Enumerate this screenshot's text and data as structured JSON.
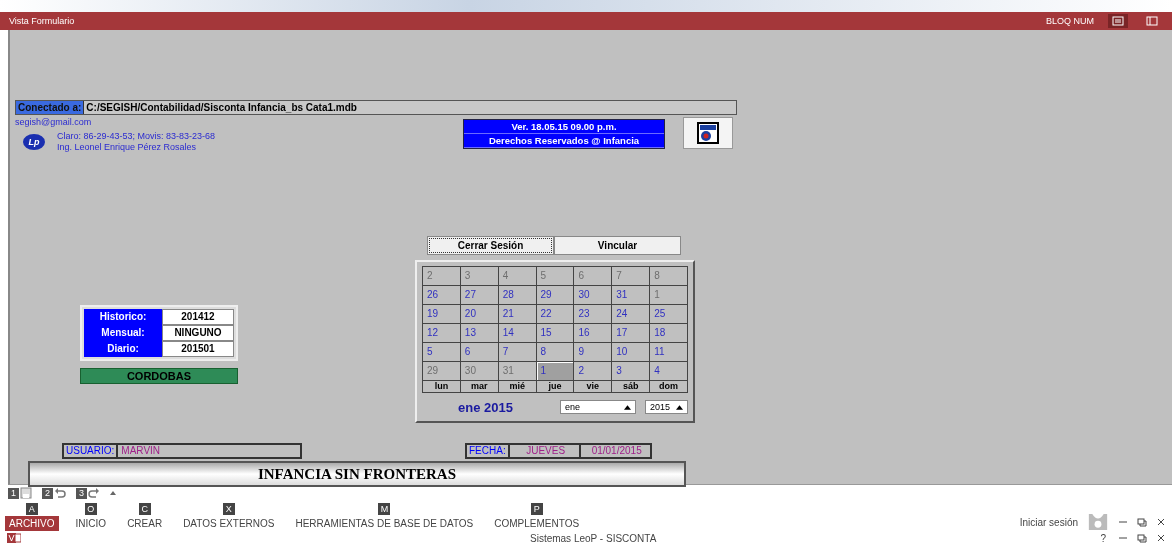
{
  "status_bar": {
    "left": "Vista Formulario",
    "right": "BLOQ NUM"
  },
  "form": {
    "connection": {
      "label": "Conectado a:",
      "path": "C:/SEGISH/Contabilidad/Sisconta Infancia_bs Cata1.mdb"
    },
    "contact": {
      "email": "segish@gmail.com",
      "logo": "Lp",
      "phone": "Claro: 86-29-43-53; Movis: 83-83-23-68",
      "name": "Ing. Leonel Enrique Pérez Rosales"
    },
    "copyright": {
      "version": "Ver. 18.05.15 09.00 p.m.",
      "rights": "Derechos Reservados @ Infancia"
    },
    "buttons": [
      {
        "label": "Cerrar Sesión",
        "focused": true
      },
      {
        "label": "Vincular",
        "focused": false
      }
    ],
    "calendar": {
      "weeks": [
        [
          {
            "day": "2",
            "in_month": false,
            "selected": false
          },
          {
            "day": "3",
            "in_month": false,
            "selected": false
          },
          {
            "day": "4",
            "in_month": false,
            "selected": false
          },
          {
            "day": "5",
            "in_month": false,
            "selected": false
          },
          {
            "day": "6",
            "in_month": false,
            "selected": false
          },
          {
            "day": "7",
            "in_month": false,
            "selected": false
          },
          {
            "day": "8",
            "in_month": false,
            "selected": false
          }
        ],
        [
          {
            "day": "26",
            "in_month": true,
            "selected": false
          },
          {
            "day": "27",
            "in_month": true,
            "selected": false
          },
          {
            "day": "28",
            "in_month": true,
            "selected": false
          },
          {
            "day": "29",
            "in_month": true,
            "selected": false
          },
          {
            "day": "30",
            "in_month": true,
            "selected": false
          },
          {
            "day": "31",
            "in_month": true,
            "selected": false
          },
          {
            "day": "1",
            "in_month": false,
            "selected": false
          }
        ],
        [
          {
            "day": "19",
            "in_month": true,
            "selected": false
          },
          {
            "day": "20",
            "in_month": true,
            "selected": false
          },
          {
            "day": "21",
            "in_month": true,
            "selected": false
          },
          {
            "day": "22",
            "in_month": true,
            "selected": false
          },
          {
            "day": "23",
            "in_month": true,
            "selected": false
          },
          {
            "day": "24",
            "in_month": true,
            "selected": false
          },
          {
            "day": "25",
            "in_month": true,
            "selected": false
          }
        ],
        [
          {
            "day": "12",
            "in_month": true,
            "selected": false
          },
          {
            "day": "13",
            "in_month": true,
            "selected": false
          },
          {
            "day": "14",
            "in_month": true,
            "selected": false
          },
          {
            "day": "15",
            "in_month": true,
            "selected": false
          },
          {
            "day": "16",
            "in_month": true,
            "selected": false
          },
          {
            "day": "17",
            "in_month": true,
            "selected": false
          },
          {
            "day": "18",
            "in_month": true,
            "selected": false
          }
        ],
        [
          {
            "day": "5",
            "in_month": true,
            "selected": false
          },
          {
            "day": "6",
            "in_month": true,
            "selected": false
          },
          {
            "day": "7",
            "in_month": true,
            "selected": false
          },
          {
            "day": "8",
            "in_month": true,
            "selected": false
          },
          {
            "day": "9",
            "in_month": true,
            "selected": false
          },
          {
            "day": "10",
            "in_month": true,
            "selected": false
          },
          {
            "day": "11",
            "in_month": true,
            "selected": false
          }
        ],
        [
          {
            "day": "29",
            "in_month": false,
            "selected": false
          },
          {
            "day": "30",
            "in_month": false,
            "selected": false
          },
          {
            "day": "31",
            "in_month": false,
            "selected": false
          },
          {
            "day": "1",
            "in_month": true,
            "selected": true
          },
          {
            "day": "2",
            "in_month": true,
            "selected": false
          },
          {
            "day": "3",
            "in_month": true,
            "selected": false
          },
          {
            "day": "4",
            "in_month": true,
            "selected": false
          }
        ]
      ],
      "weekdays": [
        "lun",
        "mar",
        "mié",
        "jue",
        "vie",
        "sáb",
        "dom"
      ],
      "month_label": "ene 2015",
      "month": "ene",
      "year": "2015"
    },
    "periods": [
      {
        "label": "Historico:",
        "value": "201412"
      },
      {
        "label": "Mensual:",
        "value": "NINGUNO"
      },
      {
        "label": "Diario:",
        "value": "201501"
      }
    ],
    "currency": "CORDOBAS",
    "user": {
      "label": "USUARIO:",
      "value": "MARVIN"
    },
    "date": {
      "label": "FECHA:",
      "weekday": "JUEVES",
      "date": "01/01/2015"
    },
    "banner": "INFANCIA SIN FRONTERAS"
  },
  "quick_access": [
    {
      "kind": "save",
      "key": "1"
    },
    {
      "kind": "undo",
      "key": "2"
    },
    {
      "kind": "redo",
      "key": "3"
    }
  ],
  "ribbon": {
    "tabs": [
      {
        "label": "ARCHIVO",
        "key": "A",
        "selected": true
      },
      {
        "label": "INICIO",
        "key": "O",
        "selected": false
      },
      {
        "label": "CREAR",
        "key": "C",
        "selected": false
      },
      {
        "label": "DATOS EXTERNOS",
        "key": "X",
        "selected": false
      },
      {
        "label": "HERRAMIENTAS DE BASE DE DATOS",
        "key": "M",
        "selected": false
      },
      {
        "label": "COMPLEMENTOS",
        "key": "P",
        "selected": false
      }
    ],
    "account": "Iniciar sesión"
  },
  "title_bar": {
    "title": "Sistemas LeoP - SISCONTA",
    "help": "?"
  }
}
